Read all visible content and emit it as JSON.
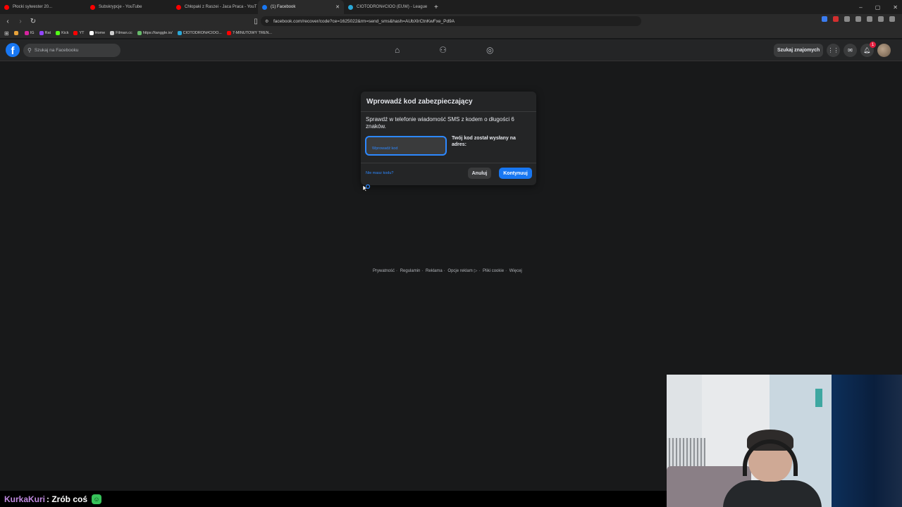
{
  "browser": {
    "tabs": [
      {
        "label": "Płocki sylwester 20...",
        "color": "#ff0000",
        "active": false
      },
      {
        "label": "Subskrypcje - YouTube",
        "color": "#ff0000",
        "active": false
      },
      {
        "label": "Chłopaki z Raszei - Jaca Praca - YouT",
        "color": "#ff0000",
        "active": false
      },
      {
        "label": "(1) Facebook",
        "color": "#1877f2",
        "active": true
      },
      {
        "label": "CIOTODRON#CIOO (EUW) - League",
        "color": "#2aa8d8",
        "active": false
      }
    ],
    "new_tab": "+",
    "window_controls": [
      "–",
      "▢",
      "✕"
    ],
    "url": "facebook.com/recover/code?ce=1625022&rm=send_sms&hash=AUbXlrCtnKwFxe_Pd9A",
    "bookmarks": [
      {
        "label": "",
        "color": "#e8a23a"
      },
      {
        "label": "IG",
        "color": "#d6249f"
      },
      {
        "label": "Rat",
        "color": "#9146ff"
      },
      {
        "label": "Kick",
        "color": "#53fc18"
      },
      {
        "label": "YT",
        "color": "#ff0000"
      },
      {
        "label": "Home",
        "color": "#ffffff"
      },
      {
        "label": "Filman.cc",
        "color": "#cccccc"
      },
      {
        "label": "https://tanggle.io/",
        "color": "#66bb6a"
      },
      {
        "label": "CIOTODRON#CIOO...",
        "color": "#2aa8d8"
      },
      {
        "label": "7-MINUTOWY TREN...",
        "color": "#ff0000"
      }
    ]
  },
  "facebook": {
    "logo": "f",
    "search_placeholder": "Szukaj na Facebooku",
    "find_friends": "Szukaj znajomych",
    "notification_count": "1"
  },
  "modal": {
    "title": "Wprowadź kod zabezpieczający",
    "description": "Sprawdź w telefonie wiadomość SMS z kodem o długości 6 znaków.",
    "code_placeholder": "Wprowadź kod",
    "sent_to": "Twój kod został wysłany na adres:",
    "no_code_link": "Nie masz kodu?",
    "cancel_label": "Anuluj",
    "continue_label": "Kontynuuj"
  },
  "footer": {
    "links": [
      "Prywatność",
      "Regulamin",
      "Reklama",
      "Opcje reklam",
      "Pliki cookie",
      "Więcej"
    ],
    "separator": "·"
  },
  "chat": {
    "user": "KurkaKuri",
    "message": ": Zrób coś"
  }
}
